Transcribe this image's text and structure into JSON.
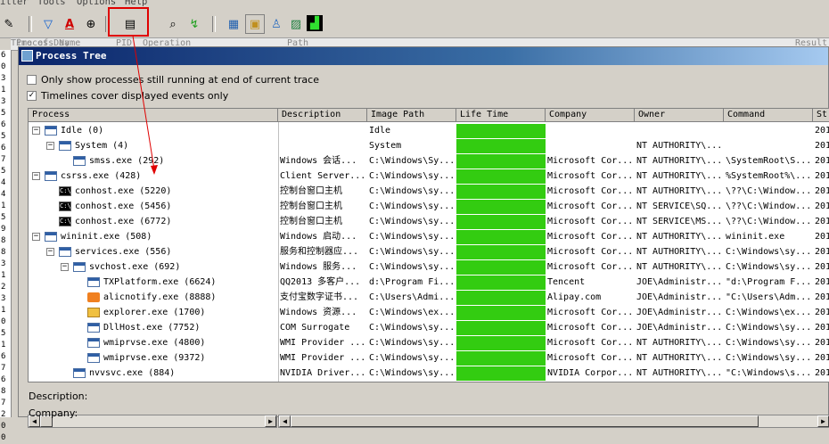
{
  "menubar": {
    "items": [
      "ilter",
      "Tools",
      "Options",
      "Help"
    ]
  },
  "toolbar": {
    "icons": [
      "properties-icon",
      "filter-icon",
      "highlight-icon",
      "target-icon",
      "process-tree-icon",
      "find-icon",
      "jump-icon",
      "registry-activity-icon",
      "file-activity-icon",
      "network-activity-icon",
      "process-activity-icon",
      "profiling-icon"
    ]
  },
  "background_header": {
    "columns": [
      "Time of Day",
      "Process Name",
      "PID",
      "Operation",
      "Path",
      "Result"
    ]
  },
  "gutter_digits": [
    "6",
    "0",
    "3",
    "1",
    "3",
    "5",
    "6",
    "5",
    "6",
    "7",
    "5",
    "4",
    "4",
    "1",
    "5",
    "9",
    "8",
    "8",
    "3",
    "1",
    "2",
    "3",
    "1",
    "0",
    "5",
    "1",
    "6",
    "7",
    "6",
    "8",
    "7",
    "2",
    "0",
    "0"
  ],
  "dialog": {
    "title": "Process Tree",
    "option1_label": "Only show processes still running at end of current trace",
    "option1_checked": false,
    "option2_label": "Timelines cover displayed events only",
    "option2_checked": true,
    "columns": [
      "Process",
      "Description",
      "Image Path",
      "Life Time",
      "Company",
      "Owner",
      "Command",
      "St"
    ],
    "rows": [
      {
        "indent": 0,
        "toggle": "-",
        "icon": "window",
        "process": "Idle (0)",
        "description": "",
        "image_path": "Idle",
        "company": "",
        "owner": "",
        "command": "",
        "start": "201"
      },
      {
        "indent": 1,
        "toggle": "-",
        "icon": "window",
        "process": "System (4)",
        "description": "",
        "image_path": "System",
        "company": "",
        "owner": "NT AUTHORITY\\...",
        "command": "",
        "start": "201"
      },
      {
        "indent": 2,
        "toggle": "",
        "icon": "window",
        "process": "smss.exe (292)",
        "description": "Windows 会话...",
        "image_path": "C:\\Windows\\Sy...",
        "company": "Microsoft Cor...",
        "owner": "NT AUTHORITY\\...",
        "command": "\\SystemRoot\\S...",
        "start": "201"
      },
      {
        "indent": 0,
        "toggle": "-",
        "icon": "window",
        "process": "csrss.exe (428)",
        "description": "Client Server...",
        "image_path": "C:\\Windows\\sy...",
        "company": "Microsoft Cor...",
        "owner": "NT AUTHORITY\\...",
        "command": "%SystemRoot%\\...",
        "start": "201"
      },
      {
        "indent": 1,
        "toggle": "",
        "icon": "console",
        "process": "conhost.exe (5220)",
        "description": "控制台窗口主机",
        "image_path": "C:\\Windows\\sy...",
        "company": "Microsoft Cor...",
        "owner": "NT AUTHORITY\\...",
        "command": "\\??\\C:\\Window...",
        "start": "201"
      },
      {
        "indent": 1,
        "toggle": "",
        "icon": "console",
        "process": "conhost.exe (5456)",
        "description": "控制台窗口主机",
        "image_path": "C:\\Windows\\sy...",
        "company": "Microsoft Cor...",
        "owner": "NT SERVICE\\SQ...",
        "command": "\\??\\C:\\Window...",
        "start": "201"
      },
      {
        "indent": 1,
        "toggle": "",
        "icon": "console",
        "process": "conhost.exe (6772)",
        "description": "控制台窗口主机",
        "image_path": "C:\\Windows\\sy...",
        "company": "Microsoft Cor...",
        "owner": "NT SERVICE\\MS...",
        "command": "\\??\\C:\\Window...",
        "start": "201"
      },
      {
        "indent": 0,
        "toggle": "-",
        "icon": "window",
        "process": "wininit.exe (508)",
        "description": "Windows 启动...",
        "image_path": "C:\\Windows\\sy...",
        "company": "Microsoft Cor...",
        "owner": "NT AUTHORITY\\...",
        "command": "wininit.exe",
        "start": "201"
      },
      {
        "indent": 1,
        "toggle": "-",
        "icon": "window",
        "process": "services.exe (556)",
        "description": "服务和控制器应...",
        "image_path": "C:\\Windows\\sy...",
        "company": "Microsoft Cor...",
        "owner": "NT AUTHORITY\\...",
        "command": "C:\\Windows\\sy...",
        "start": "201"
      },
      {
        "indent": 2,
        "toggle": "-",
        "icon": "window",
        "process": "svchost.exe (692)",
        "description": "Windows 服务...",
        "image_path": "C:\\Windows\\sy...",
        "company": "Microsoft Cor...",
        "owner": "NT AUTHORITY\\...",
        "command": "C:\\Windows\\sy...",
        "start": "201"
      },
      {
        "indent": 3,
        "toggle": "",
        "icon": "window",
        "process": "TXPlatform.exe (6624)",
        "description": "QQ2013 多客户...",
        "image_path": "d:\\Program Fi...",
        "company": "Tencent",
        "owner": "JOE\\Administr...",
        "command": "\"d:\\Program F...",
        "start": "201"
      },
      {
        "indent": 3,
        "toggle": "",
        "icon": "orange",
        "process": "alicnotify.exe (8888)",
        "description": "支付宝数字证书...",
        "image_path": "C:\\Users\\Admi...",
        "company": "Alipay.com",
        "owner": "JOE\\Administr...",
        "command": "\"C:\\Users\\Adm...",
        "start": "201"
      },
      {
        "indent": 3,
        "toggle": "",
        "icon": "folder",
        "process": "explorer.exe (1700)",
        "description": "Windows 资源...",
        "image_path": "C:\\Windows\\ex...",
        "company": "Microsoft Cor...",
        "owner": "JOE\\Administr...",
        "command": "C:\\Windows\\ex...",
        "start": "201"
      },
      {
        "indent": 3,
        "toggle": "",
        "icon": "window",
        "process": "DllHost.exe (7752)",
        "description": "COM Surrogate",
        "image_path": "C:\\Windows\\sy...",
        "company": "Microsoft Cor...",
        "owner": "JOE\\Administr...",
        "command": "C:\\Windows\\sy...",
        "start": "201"
      },
      {
        "indent": 3,
        "toggle": "",
        "icon": "window",
        "process": "wmiprvse.exe (4800)",
        "description": "WMI Provider ...",
        "image_path": "C:\\Windows\\sy...",
        "company": "Microsoft Cor...",
        "owner": "NT AUTHORITY\\...",
        "command": "C:\\Windows\\sy...",
        "start": "201"
      },
      {
        "indent": 3,
        "toggle": "",
        "icon": "window",
        "process": "wmiprvse.exe (9372)",
        "description": "WMI Provider ...",
        "image_path": "C:\\Windows\\sy...",
        "company": "Microsoft Cor...",
        "owner": "NT AUTHORITY\\...",
        "command": "C:\\Windows\\sy...",
        "start": "201"
      },
      {
        "indent": 2,
        "toggle": "",
        "icon": "window",
        "process": "nvvsvc.exe (884)",
        "description": "NVIDIA Driver...",
        "image_path": "C:\\Windows\\sy...",
        "company": "NVIDIA Corpor...",
        "owner": "NT AUTHORITY\\...",
        "command": "\"C:\\Windows\\s...",
        "start": "201"
      }
    ],
    "bottom": {
      "description_label": "Description:",
      "company_label": "Company:"
    }
  },
  "colors": {
    "lifetime_bar": "#33cc11",
    "annotation": "#e00000",
    "title_gradient_start": "#0a246a"
  }
}
